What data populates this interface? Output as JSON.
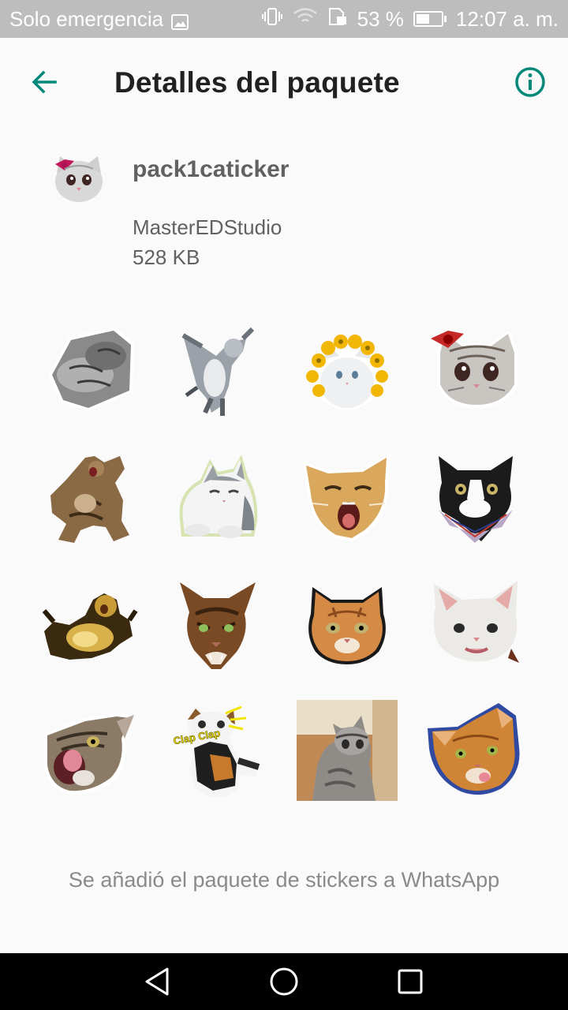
{
  "status_bar": {
    "carrier": "Solo emergencia",
    "battery_percent": "53 %",
    "battery_level": 0.53,
    "time": "12:07 a. m.",
    "icons": [
      "gallery-icon",
      "vibrate-icon",
      "wifi-icon",
      "data-saver-icon",
      "battery-icon"
    ]
  },
  "app_bar": {
    "title": "Detalles del paquete",
    "back_icon": "arrow-back-icon",
    "info_icon": "info-icon"
  },
  "pack": {
    "name": "pack1caticker",
    "publisher": "MasterEDStudio",
    "size": "528 KB"
  },
  "stickers": [
    {
      "label": "sleeping cats (grayscale)"
    },
    {
      "label": "dancing gray cat"
    },
    {
      "label": "white cat with sunflower crown"
    },
    {
      "label": "cat with red bow"
    },
    {
      "label": "surprised tabby standing"
    },
    {
      "label": "relaxed white and gray cat"
    },
    {
      "label": "yawning orange cat"
    },
    {
      "label": "black and white cat with bandana"
    },
    {
      "label": "cat lying on back"
    },
    {
      "label": "angry tabby face"
    },
    {
      "label": "orange cat face"
    },
    {
      "label": "white cat face"
    },
    {
      "label": "tabby licking lips"
    },
    {
      "label": "calico cat clapping"
    },
    {
      "label": "gray tabby on floor"
    },
    {
      "label": "ginger cat licking lips"
    }
  ],
  "sticker_text": {
    "clap": "Clap Clap"
  },
  "status_message": "Se añadió el paquete de stickers a WhatsApp",
  "nav": {
    "back_icon": "nav-back-icon",
    "home_icon": "nav-home-icon",
    "recents_icon": "nav-recents-icon"
  },
  "colors": {
    "accent": "#00897b",
    "status_bar": "#bdbdbd",
    "nav_bar": "#000000"
  }
}
